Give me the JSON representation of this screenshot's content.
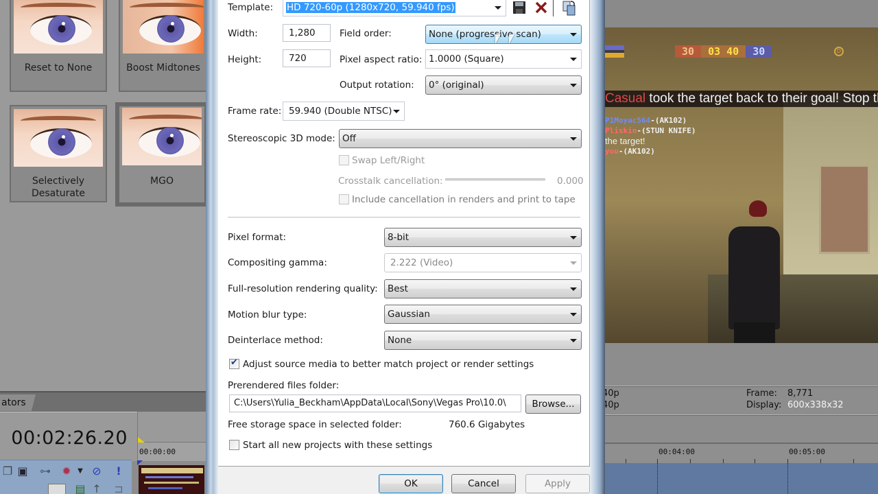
{
  "presets": [
    {
      "label": "Reset to None",
      "selected": false
    },
    {
      "label": "Boost Midtones",
      "selected": false
    },
    {
      "label": "Selectively Desaturate",
      "selected": false
    },
    {
      "label": "MGO",
      "selected": true
    }
  ],
  "left_tab": {
    "label": "ators"
  },
  "timeline": {
    "current_time": "00:02:26.20",
    "ruler_labels": [
      "00:00:00",
      "00:04:00",
      "00:05:00"
    ]
  },
  "track_toolbar": {
    "icons": [
      "overlay-icon",
      "pan-crop-icon",
      "envelope-icon",
      "fx-gear-icon",
      "mute-icon",
      "alert-icon"
    ]
  },
  "dialog": {
    "template_label": "Template:",
    "template_value": "HD 720-60p (1280x720, 59.940 fps)",
    "template_icons": [
      "save-template-icon",
      "delete-template-icon",
      "match-media-settings-icon"
    ],
    "width_label": "Width:",
    "width_value": "1,280",
    "height_label": "Height:",
    "height_value": "720",
    "field_order_label": "Field order:",
    "field_order_value": "None (progressive scan)",
    "pixel_aspect_label": "Pixel aspect ratio:",
    "pixel_aspect_value": "1.0000 (Square)",
    "output_rotation_label": "Output rotation:",
    "output_rotation_value": "0° (original)",
    "frame_rate_label": "Frame rate:",
    "frame_rate_value": "59.940 (Double NTSC)",
    "stereo_label": "Stereoscopic 3D mode:",
    "stereo_value": "Off",
    "swap_label": "Swap Left/Right",
    "swap_checked": false,
    "crosstalk_label": "Crosstalk cancellation:",
    "crosstalk_value": "0.000",
    "include_cancel_label": "Include cancellation in renders and print to tape",
    "include_cancel_checked": false,
    "pixel_format_label": "Pixel format:",
    "pixel_format_value": "8-bit",
    "gamma_label": "Compositing gamma:",
    "gamma_value": "2.222 (Video)",
    "quality_label": "Full-resolution rendering quality:",
    "quality_value": "Best",
    "motion_blur_label": "Motion blur type:",
    "motion_blur_value": "Gaussian",
    "deinterlace_label": "Deinterlace method:",
    "deinterlace_value": "None",
    "adjust_source_label": "Adjust source media to better match project or render settings",
    "adjust_source_checked": true,
    "prerendered_label": "Prerendered files folder:",
    "prerendered_value": "C:\\Users\\Yulia_Beckham\\AppData\\Local\\Sony\\Vegas Pro\\10.0\\",
    "browse_label": "Browse...",
    "free_space_label": "Free storage space in selected folder:",
    "free_space_value": "760.6 Gigabytes",
    "start_new_label": "Start all new projects with these settings",
    "start_new_checked": false,
    "ok_label": "OK",
    "cancel_label": "Cancel",
    "apply_label": "Apply"
  },
  "preview": {
    "hud_score_left": "30",
    "hud_timer": "03 40",
    "hud_score_right": "30",
    "hud_banner_name": "Casual",
    "hud_banner_text": " took the target back to their goal! Stop th",
    "kill_feed": [
      {
        "name": "P1Moyac564",
        "weapon": "-(AK102)",
        "team": "blue"
      },
      {
        "name": "Pliskin",
        "weapon": "-(STUN KNIFE)",
        "team": "red"
      },
      {
        "name": "",
        "weapon": "the target!",
        "team": "plain"
      },
      {
        "name": "you",
        "weapon": "-(AK102)",
        "team": "red"
      }
    ]
  },
  "status": {
    "left_line1": "40p",
    "left_line2": "40p",
    "frame_label": "Frame:",
    "frame_value": "8,771",
    "display_label": "Display:",
    "display_value": "600x338x32"
  },
  "colors": {
    "selection": "#3399ff",
    "dialog_bg": "#ffffff",
    "app_gray": "#8c8c8c",
    "track_blue": "#6079a0"
  }
}
